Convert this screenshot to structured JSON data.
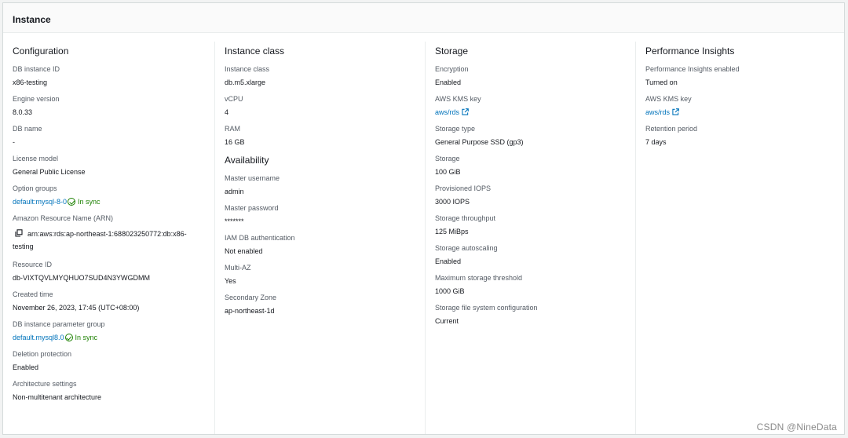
{
  "panel": {
    "title": "Instance"
  },
  "configuration": {
    "title": "Configuration",
    "db_instance_id": {
      "label": "DB instance ID",
      "value": "x86-testing"
    },
    "engine_version": {
      "label": "Engine version",
      "value": "8.0.33"
    },
    "db_name": {
      "label": "DB name",
      "value": "-"
    },
    "license_model": {
      "label": "License model",
      "value": "General Public License"
    },
    "option_groups": {
      "label": "Option groups",
      "link": "default:mysql-8-0",
      "status": "In sync"
    },
    "arn": {
      "label": "Amazon Resource Name (ARN)",
      "value_line1": "arn:aws:rds:ap-northeast-1:688023250772:db:x86-",
      "value_line2": "testing"
    },
    "resource_id": {
      "label": "Resource ID",
      "value": "db-VIXTQVLMYQHUO7SUD4N3YWGDMM"
    },
    "created_time": {
      "label": "Created time",
      "value": "November 26, 2023, 17:45 (UTC+08:00)"
    },
    "param_group": {
      "label": "DB instance parameter group",
      "link": "default.mysql8.0",
      "status": "In sync"
    },
    "deletion_protection": {
      "label": "Deletion protection",
      "value": "Enabled"
    },
    "architecture": {
      "label": "Architecture settings",
      "value": "Non-multitenant architecture"
    }
  },
  "instance_class": {
    "title": "Instance class",
    "class": {
      "label": "Instance class",
      "value": "db.m5.xlarge"
    },
    "vcpu": {
      "label": "vCPU",
      "value": "4"
    },
    "ram": {
      "label": "RAM",
      "value": "16 GB"
    }
  },
  "availability": {
    "title": "Availability",
    "master_username": {
      "label": "Master username",
      "value": "admin"
    },
    "master_password": {
      "label": "Master password",
      "value": "*******"
    },
    "iam_auth": {
      "label": "IAM DB authentication",
      "value": "Not enabled"
    },
    "multi_az": {
      "label": "Multi-AZ",
      "value": "Yes"
    },
    "secondary_zone": {
      "label": "Secondary Zone",
      "value": "ap-northeast-1d"
    }
  },
  "storage": {
    "title": "Storage",
    "encryption": {
      "label": "Encryption",
      "value": "Enabled"
    },
    "kms_key": {
      "label": "AWS KMS key",
      "link": "aws/rds"
    },
    "storage_type": {
      "label": "Storage type",
      "value": "General Purpose SSD (gp3)"
    },
    "storage": {
      "label": "Storage",
      "value": "100 GiB"
    },
    "iops": {
      "label": "Provisioned IOPS",
      "value": "3000 IOPS"
    },
    "throughput": {
      "label": "Storage throughput",
      "value": "125 MiBps"
    },
    "autoscaling": {
      "label": "Storage autoscaling",
      "value": "Enabled"
    },
    "max_threshold": {
      "label": "Maximum storage threshold",
      "value": "1000 GiB"
    },
    "fs_config": {
      "label": "Storage file system configuration",
      "value": "Current"
    }
  },
  "performance": {
    "title": "Performance Insights",
    "enabled": {
      "label": "Performance Insights enabled",
      "value": "Turned on"
    },
    "kms_key": {
      "label": "AWS KMS key",
      "link": "aws/rds"
    },
    "retention": {
      "label": "Retention period",
      "value": "7 days"
    }
  },
  "watermark": "CSDN @NineData",
  "icons": {
    "status_ok": "status-positive-icon",
    "external": "external-link-icon",
    "copy": "copy-icon"
  },
  "colors": {
    "link": "#0073bb",
    "success": "#1d8102",
    "label": "#545b64"
  }
}
